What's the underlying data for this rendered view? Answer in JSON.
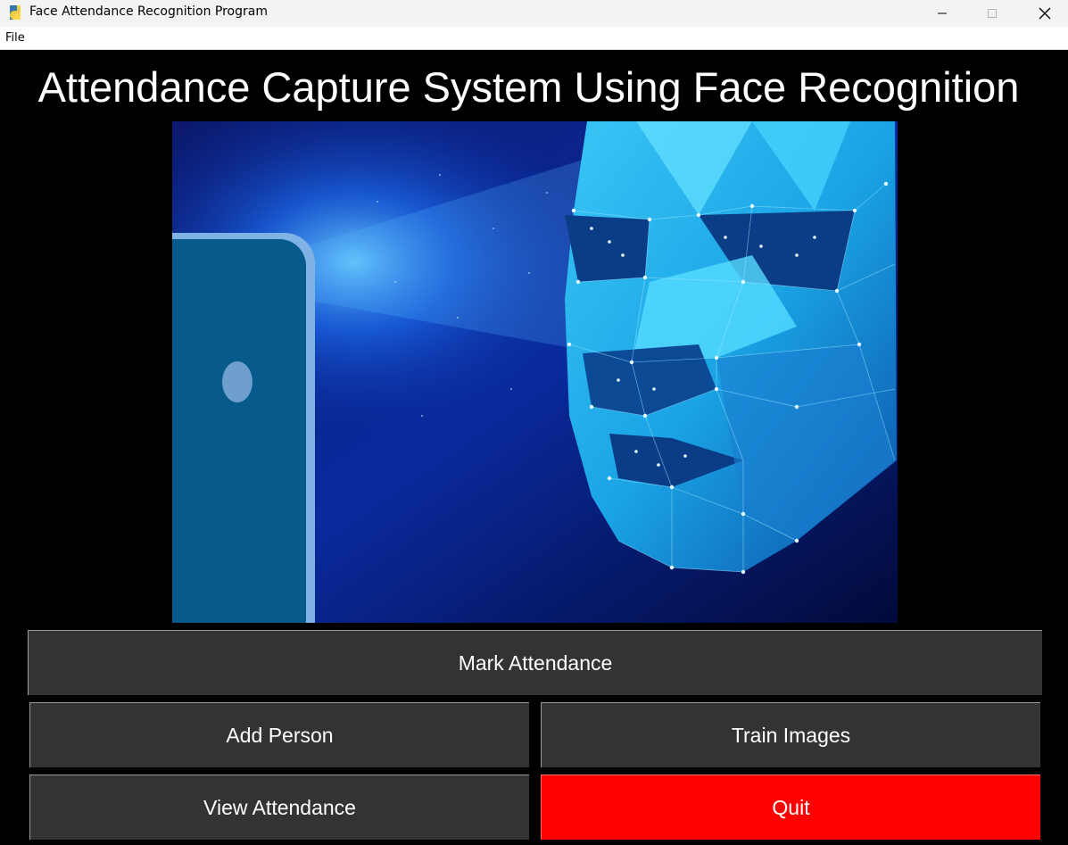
{
  "window": {
    "title": "Face Attendance Recognition Program",
    "controls": [
      "minimize-icon",
      "maximize-icon",
      "close-icon"
    ]
  },
  "menu": {
    "file_label": "File"
  },
  "heading": "Attendance Capture System Using Face Recognition",
  "hero_image": {
    "icon": "face-recognition-illustration"
  },
  "buttons": {
    "mark_attendance": "Mark Attendance",
    "add_person": "Add Person",
    "train_images": "Train Images",
    "view_attendance": "View Attendance",
    "quit": "Quit"
  },
  "colors": {
    "background": "#000000",
    "button": "#333333",
    "quit_button": "#ff0000",
    "text": "#ffffff"
  }
}
